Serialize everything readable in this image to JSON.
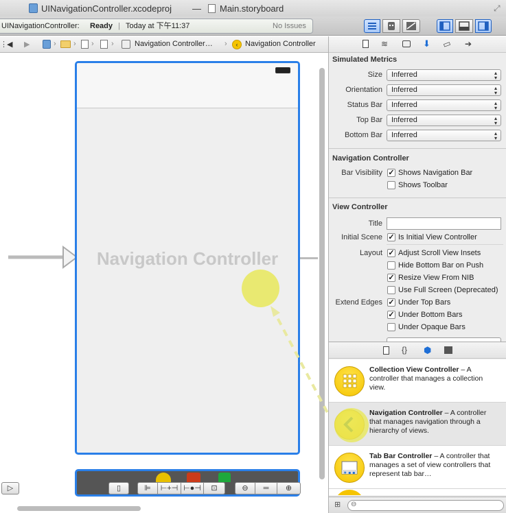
{
  "window": {
    "project_name": "UINavigationController.xcodeproj",
    "separator": "—",
    "file_name": "Main.storyboard"
  },
  "activity": {
    "target": "UINavigationController:",
    "status": "Ready",
    "separator": "|",
    "time": "Today at 下午11:37",
    "issues": "No Issues"
  },
  "jumpbar": {
    "crumb_scene": "Navigation Controller…",
    "crumb_object": "Navigation Controller"
  },
  "canvas": {
    "scene_label": "Navigation Controller"
  },
  "inspector": {
    "simulated_metrics": {
      "title": "Simulated Metrics",
      "rows": [
        {
          "label": "Size",
          "value": "Inferred"
        },
        {
          "label": "Orientation",
          "value": "Inferred"
        },
        {
          "label": "Status Bar",
          "value": "Inferred"
        },
        {
          "label": "Top Bar",
          "value": "Inferred"
        },
        {
          "label": "Bottom Bar",
          "value": "Inferred"
        }
      ]
    },
    "navigation_controller": {
      "title": "Navigation Controller",
      "bar_visibility_label": "Bar Visibility",
      "shows_navigation_bar": "Shows Navigation Bar",
      "shows_toolbar": "Shows Toolbar"
    },
    "view_controller": {
      "title": "View Controller",
      "title_label": "Title",
      "title_value": "",
      "initial_scene_label": "Initial Scene",
      "is_initial": "Is Initial View Controller",
      "layout_label": "Layout",
      "adjust_scroll": "Adjust Scroll View Insets",
      "hide_bottom_bar": "Hide Bottom Bar on Push",
      "resize_view": "Resize View From NIB",
      "use_full_screen": "Use Full Screen (Deprecated)",
      "extend_edges_label": "Extend Edges",
      "under_top": "Under Top Bars",
      "under_bottom": "Under Bottom Bars",
      "under_opaque": "Under Opaque Bars"
    }
  },
  "library": {
    "items": [
      {
        "name": "Collection View Controller",
        "desc": " – A controller that manages a collection view."
      },
      {
        "name": "Navigation Controller",
        "desc": " – A controller that manages navigation through a hierarchy of views."
      },
      {
        "name": "Tab Bar Controller",
        "desc": " – A controller that manages a set of view controllers that represent tab bar…"
      }
    ]
  },
  "colors": {
    "selection_blue": "#2a7fe8",
    "drag_yellow": "#e8e85a"
  }
}
